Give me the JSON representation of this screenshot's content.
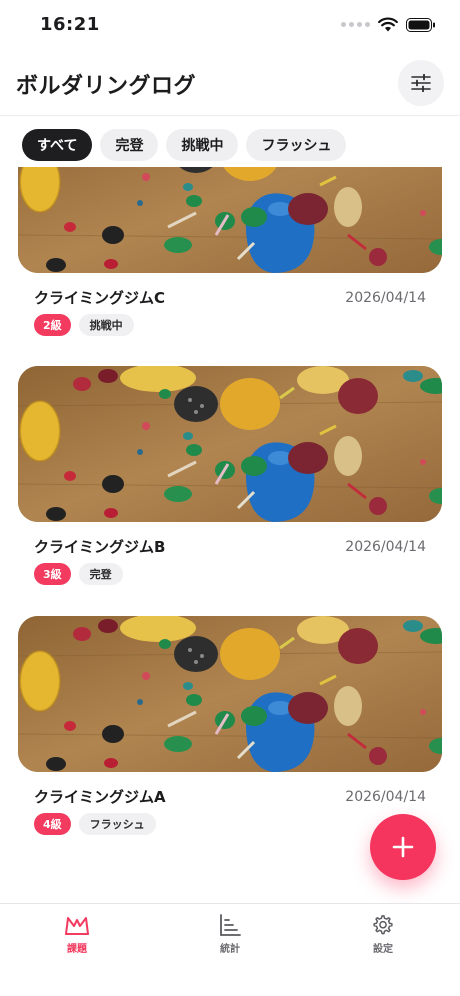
{
  "status_bar": {
    "time": "16:21"
  },
  "header": {
    "title": "ボルダリングログ"
  },
  "filters": [
    {
      "label": "すべて",
      "active": true
    },
    {
      "label": "完登",
      "active": false
    },
    {
      "label": "挑戦中",
      "active": false
    },
    {
      "label": "フラッシュ",
      "active": false
    }
  ],
  "records": [
    {
      "gym": "クライミングジムC",
      "date": "2026/04/14",
      "grade": "2級",
      "status": "挑戦中"
    },
    {
      "gym": "クライミングジムB",
      "date": "2026/04/14",
      "grade": "3級",
      "status": "完登"
    },
    {
      "gym": "クライミングジムA",
      "date": "2026/04/14",
      "grade": "4級",
      "status": "フラッシュ"
    }
  ],
  "tabs": [
    {
      "label": "課題",
      "active": true
    },
    {
      "label": "統計",
      "active": false
    },
    {
      "label": "設定",
      "active": false
    }
  ],
  "colors": {
    "accent": "#f5355e",
    "chip_active": "#1e1e21",
    "wall": "#a37843"
  },
  "icons": {
    "filter": "sliders-icon",
    "add": "plus-icon",
    "tab_tasks": "mountain-icon",
    "tab_stats": "bar-chart-icon",
    "tab_settings": "gear-icon"
  }
}
